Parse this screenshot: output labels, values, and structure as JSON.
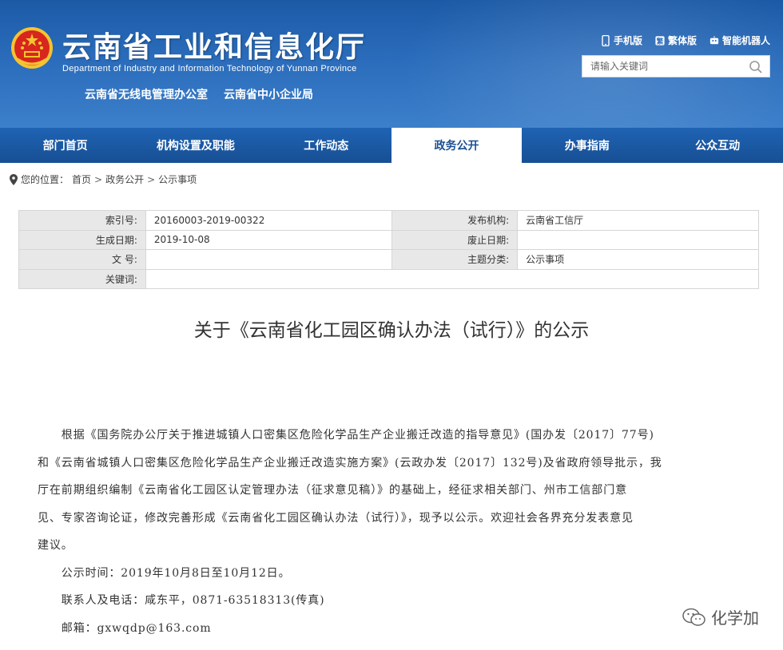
{
  "header": {
    "site_title": "云南省工业和信息化厅",
    "site_subtitle": "Department of Industry and Information Technology of Yunnan Province",
    "sub_links": [
      "云南省无线电管理办公室",
      "云南省中小企业局"
    ],
    "tools": [
      {
        "label": "手机版",
        "icon": "mobile-icon"
      },
      {
        "label": "繁体版",
        "icon": "traditional-chinese-icon"
      },
      {
        "label": "智能机器人",
        "icon": "robot-icon"
      }
    ],
    "search_placeholder": "请输入关键词",
    "colors": {
      "header_bg": "#2a6cbb",
      "nav_bg": "#1a56a0",
      "emblem_red": "#d8261f",
      "emblem_gold": "#f4c430"
    }
  },
  "nav": {
    "items": [
      "部门首页",
      "机构设置及职能",
      "工作动态",
      "政务公开",
      "办事指南",
      "公众互动"
    ],
    "active_index": 3
  },
  "breadcrumb": {
    "prefix": "您的位置：",
    "items": [
      "首页",
      "政务公开",
      "公示事项"
    ],
    "separator": ">"
  },
  "info": {
    "rows": [
      {
        "l1": "索引号:",
        "v1": "20160003-2019-00322",
        "l2": "发布机构:",
        "v2": "云南省工信厅"
      },
      {
        "l1": "生成日期:",
        "v1": "2019-10-08",
        "l2": "废止日期:",
        "v2": ""
      },
      {
        "l1": "文 号:",
        "v1": "",
        "l2": "主题分类:",
        "v2": "公示事项"
      },
      {
        "l1": "关键词:",
        "v1": ""
      }
    ]
  },
  "article": {
    "title": "关于《云南省化工园区确认办法（试行）》的公示",
    "lines": [
      "　　根据《国务院办公厅关于推进城镇人口密集区危险化学品生产企业搬迁改造的指导意见》(国办发〔2017〕77号)",
      "和《云南省城镇人口密集区危险化学品生产企业搬迁改造实施方案》(云政办发〔2017〕132号)及省政府领导批示，我",
      "厅在前期组织编制《云南省化工园区认定管理办法（征求意见稿）》的基础上，经征求相关部门、州市工信部门意",
      "见、专家咨询论证，修改完善形成《云南省化工园区确认办法（试行）》，现予以公示。欢迎社会各界充分发表意见",
      "建议。",
      "　　公示时间：2019年10月8日至10月12日。",
      "　　联系人及电话：咸东平，0871-63518313(传真)",
      "　　邮箱：gxwqdp@163.com"
    ]
  },
  "watermark": {
    "text": "化学加",
    "icon": "wechat-icon"
  }
}
